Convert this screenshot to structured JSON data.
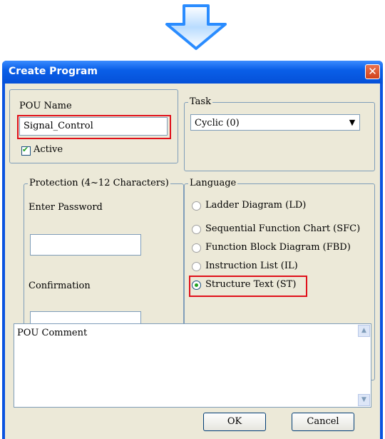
{
  "dialog": {
    "title": "Create Program",
    "close_icon": "close-icon"
  },
  "pou": {
    "name_label": "POU Name",
    "name_value": "Signal_Control",
    "active_label": "Active",
    "active_checked": true
  },
  "task": {
    "legend": "Task",
    "selected": "Cyclic (0)"
  },
  "protection": {
    "legend": "Protection (4~12 Characters)",
    "password_label": "Enter Password",
    "password_value": "",
    "confirmation_label": "Confirmation",
    "confirmation_value": ""
  },
  "language": {
    "legend": "Language",
    "options": [
      {
        "label": "Ladder Diagram (LD)",
        "selected": false
      },
      {
        "label": "Sequential Function Chart (SFC)",
        "selected": false
      },
      {
        "label": "Function Block Diagram (FBD)",
        "selected": false
      },
      {
        "label": "Instruction List (IL)",
        "selected": false
      },
      {
        "label": "Structure Text (ST)",
        "selected": true
      }
    ]
  },
  "comment": {
    "placeholder": "POU Comment"
  },
  "buttons": {
    "ok": "OK",
    "cancel": "Cancel"
  },
  "colors": {
    "highlight": "#e0101a",
    "titlebar": "#0a5fe8",
    "arrow": "#2a8cff"
  }
}
